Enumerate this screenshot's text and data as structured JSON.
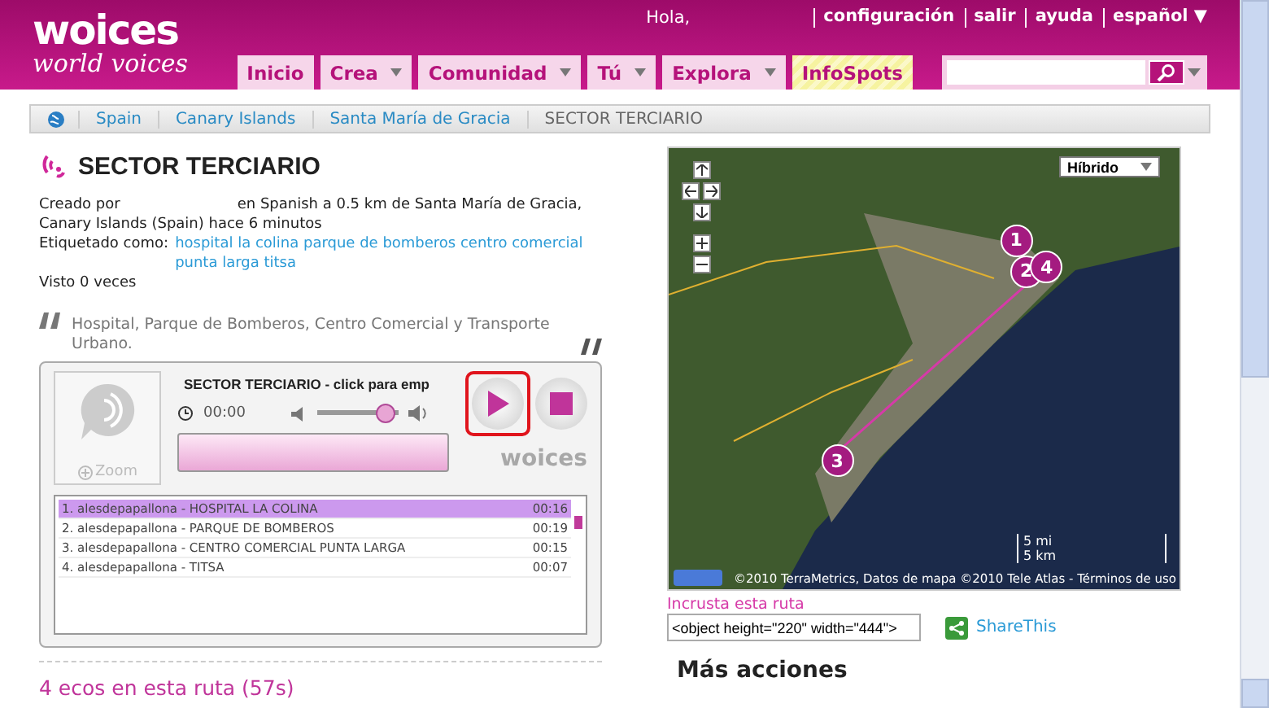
{
  "header": {
    "logo": {
      "name": "woices",
      "tagline": "world voices"
    },
    "greeting": "Hola,",
    "links": [
      "configuración",
      "salir",
      "ayuda",
      "español ▼"
    ],
    "nav": [
      {
        "label": "Inicio",
        "dropdown": false,
        "kind": "plain"
      },
      {
        "label": "Crea",
        "dropdown": true,
        "kind": "plain"
      },
      {
        "label": "Comunidad",
        "dropdown": true,
        "kind": "plain"
      },
      {
        "label": "Tú",
        "dropdown": true,
        "kind": "plain"
      },
      {
        "label": "Explora",
        "dropdown": true,
        "kind": "plain"
      },
      {
        "label": "InfoSpots",
        "dropdown": false,
        "kind": "highlight"
      }
    ]
  },
  "breadcrumb": [
    "Spain",
    "Canary Islands",
    "Santa María de Gracia",
    "SECTOR TERCIARIO"
  ],
  "route": {
    "title": "SECTOR TERCIARIO",
    "created_by": "Creado por",
    "created_rest": "en Spanish a 0.5 km de Santa María de Gracia, Canary Islands (Spain) hace 6 minutos",
    "tags_label": "Etiquetado como:",
    "tags": "hospital la colina parque de bomberos centro comercial punta larga titsa",
    "views": "Visto 0 veces",
    "description": "Hospital, Parque de Bomberos, Centro Comercial y Transporte Urbano."
  },
  "player": {
    "zoom": "Zoom",
    "title": "SECTOR TERCIARIO - click para emp",
    "time": "00:00",
    "volume": {
      "level": 0.85
    },
    "progress": {
      "level": 0
    },
    "brand": "woices",
    "play_highlighted": true,
    "playlist": [
      {
        "label": "1. alesdepapallona - HOSPITAL LA COLINA",
        "duration": "00:16",
        "selected": true
      },
      {
        "label": "2. alesdepapallona - PARQUE DE BOMBEROS",
        "duration": "00:19",
        "selected": false
      },
      {
        "label": "3. alesdepapallona - CENTRO COMERCIAL PUNTA LARGA",
        "duration": "00:15",
        "selected": false
      },
      {
        "label": "4. alesdepapallona - TITSA",
        "duration": "00:07",
        "selected": false
      }
    ]
  },
  "echoes_heading": "4 ecos en esta ruta (57s)",
  "map": {
    "type": "Híbrido",
    "markers": [
      "1",
      "2",
      "4",
      "3"
    ],
    "scale_mi": "5 mi",
    "scale_km": "5 km",
    "attribution": "©2010 TerraMetrics, Datos de mapa ©2010 Tele Atlas - Términos de uso"
  },
  "embed": {
    "label": "Incrusta esta ruta",
    "value": "<object height=\"220\" width=\"444\">"
  },
  "share": "ShareThis",
  "more_actions": "Más acciones"
}
